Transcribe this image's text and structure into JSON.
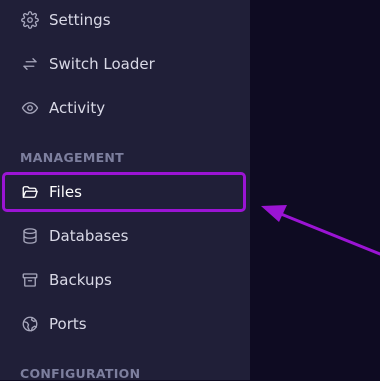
{
  "sidebar": {
    "items_top": [
      {
        "label": "Settings",
        "icon": "gear-icon"
      },
      {
        "label": "Switch Loader",
        "icon": "switch-arrows-icon"
      },
      {
        "label": "Activity",
        "icon": "eye-icon"
      }
    ],
    "sections": [
      {
        "title": "MANAGEMENT",
        "items": [
          {
            "label": "Files",
            "icon": "folder-open-icon",
            "active": true
          },
          {
            "label": "Databases",
            "icon": "database-icon"
          },
          {
            "label": "Backups",
            "icon": "archive-box-icon"
          },
          {
            "label": "Ports",
            "icon": "globe-network-icon"
          }
        ]
      },
      {
        "title": "CONFIGURATION",
        "items": []
      }
    ]
  },
  "annotation": {
    "highlight_color": "#9b14d4",
    "arrow_color": "#9b14d4",
    "target": "Files"
  },
  "colors": {
    "sidebar_bg": "#201f38",
    "main_bg": "#0e0b22",
    "text": "#d9d9e6",
    "section_label": "#7d7f9e"
  }
}
